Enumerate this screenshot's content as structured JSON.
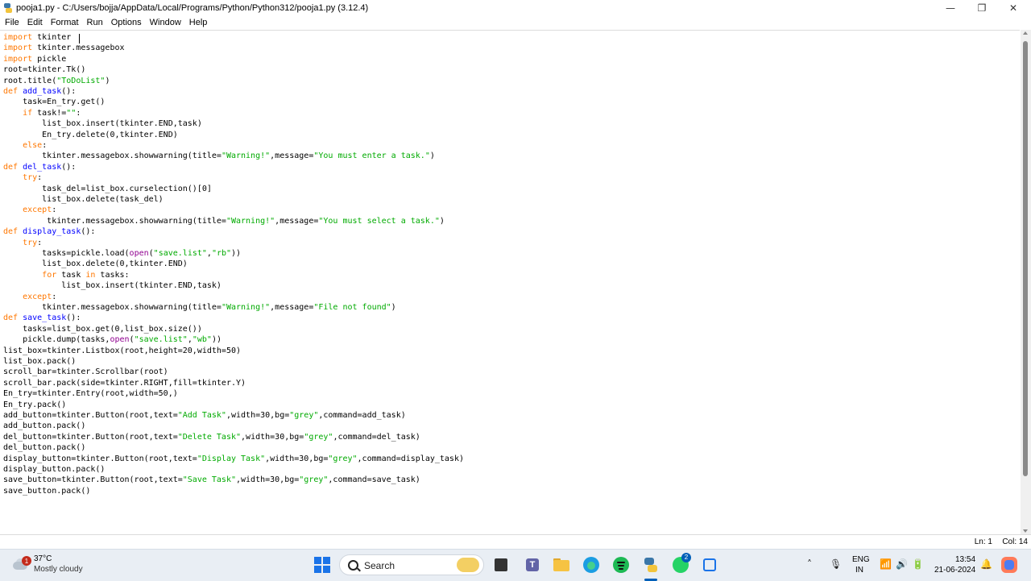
{
  "window": {
    "title": "pooja1.py - C:/Users/bojja/AppData/Local/Programs/Python/Python312/pooja1.py (3.12.4)",
    "minimize": "—",
    "maximize": "❐",
    "close": "✕"
  },
  "menu": [
    "File",
    "Edit",
    "Format",
    "Run",
    "Options",
    "Window",
    "Help"
  ],
  "code_lines": [
    "import tkinter",
    "import tkinter.messagebox",
    "import pickle",
    "root=tkinter.Tk()",
    "root.title(\"ToDoList\")",
    "def add_task():",
    "    task=En_try.get()",
    "    if task!=\"\":",
    "        list_box.insert(tkinter.END,task)",
    "        En_try.delete(0,tkinter.END)",
    "    else:",
    "        tkinter.messagebox.showwarning(title=\"Warning!\",message=\"You must enter a task.\")",
    "def del_task():",
    "    try:",
    "        task_del=list_box.curselection()[0]",
    "        list_box.delete(task_del)",
    "    except:",
    "         tkinter.messagebox.showwarning(title=\"Warning!\",message=\"You must select a task.\")",
    "def display_task():",
    "    try:",
    "        tasks=pickle.load(open(\"save.list\",\"rb\"))",
    "        list_box.delete(0,tkinter.END)",
    "        for task in tasks:",
    "            list_box.insert(tkinter.END,task)",
    "    except:",
    "        tkinter.messagebox.showwarning(title=\"Warning!\",message=\"File not found\")",
    "def save_task():",
    "    tasks=list_box.get(0,list_box.size())",
    "    pickle.dump(tasks,open(\"save.list\",\"wb\"))",
    "list_box=tkinter.Listbox(root,height=20,width=50)",
    "list_box.pack()",
    "scroll_bar=tkinter.Scrollbar(root)",
    "scroll_bar.pack(side=tkinter.RIGHT,fill=tkinter.Y)",
    "En_try=tkinter.Entry(root,width=50,)",
    "En_try.pack()",
    "add_button=tkinter.Button(root,text=\"Add Task\",width=30,bg=\"grey\",command=add_task)",
    "add_button.pack()",
    "del_button=tkinter.Button(root,text=\"Delete Task\",width=30,bg=\"grey\",command=del_task)",
    "del_button.pack()",
    "display_button=tkinter.Button(root,text=\"Display Task\",width=30,bg=\"grey\",command=display_task)",
    "display_button.pack()",
    "save_button=tkinter.Button(root,text=\"Save Task\",width=30,bg=\"grey\",command=save_task)",
    "save_button.pack()"
  ],
  "syntax_colors": {
    "keyword": "#ff7700",
    "builtin": "#900090",
    "string": "#00aa00",
    "definition": "#0000ff"
  },
  "status": {
    "line": "Ln: 1",
    "col": "Col: 14"
  },
  "taskbar": {
    "weather_badge": "1",
    "weather_temp": "37°C",
    "weather_desc": "Mostly cloudy",
    "search_label": "Search",
    "teams_letter": "T",
    "whatsapp_badge": "2",
    "lang_top": "ENG",
    "lang_bottom": "IN",
    "time": "13:54",
    "date": "21-06-2024",
    "icons": [
      "start-icon",
      "search-icon",
      "files-icon",
      "teams-icon",
      "folder-icon",
      "edge-icon",
      "spotify-icon",
      "python-idle-icon",
      "whatsapp-icon",
      "snipping-tool-icon"
    ],
    "tray_icons": [
      "chevron-up-icon",
      "microphone-icon",
      "wifi-icon",
      "volume-icon",
      "battery-icon",
      "notification-bell-icon",
      "copilot-icon"
    ]
  }
}
